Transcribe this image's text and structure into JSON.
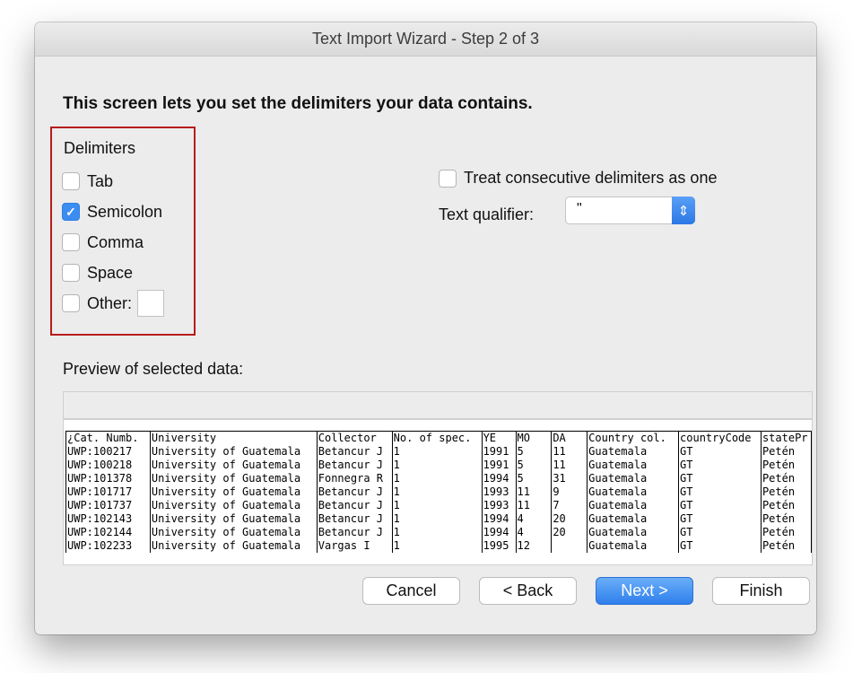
{
  "window": {
    "title": "Text Import Wizard - Step 2 of 3"
  },
  "headline": "This screen lets you set the delimiters your data contains.",
  "delimiters": {
    "title": "Delimiters",
    "tab": {
      "label": "Tab",
      "checked": false
    },
    "semicolon": {
      "label": "Semicolon",
      "checked": true
    },
    "comma": {
      "label": "Comma",
      "checked": false
    },
    "space": {
      "label": "Space",
      "checked": false
    },
    "other": {
      "label": "Other:",
      "checked": false,
      "value": ""
    }
  },
  "consecutive": {
    "label": "Treat consecutive delimiters as one",
    "checked": false
  },
  "text_qualifier": {
    "label": "Text qualifier:",
    "value": "\""
  },
  "preview": {
    "label": "Preview of selected data:",
    "headers": [
      "¿Cat. Numb.",
      "University",
      "Collector",
      "No. of spec.",
      "YE",
      "MO",
      "DA",
      "Country col.",
      "countryCode",
      "statePr"
    ],
    "rows": [
      [
        "UWP:100217",
        "University of Guatemala",
        "Betancur J",
        "1",
        "1991",
        "5",
        "11",
        "Guatemala",
        "GT",
        "Petén"
      ],
      [
        "UWP:100218",
        "University of Guatemala",
        "Betancur J",
        "1",
        "1991",
        "5",
        "11",
        "Guatemala",
        "GT",
        "Petén"
      ],
      [
        "UWP:101378",
        "University of Guatemala",
        "Fonnegra R",
        "1",
        "1994",
        "5",
        "31",
        "Guatemala",
        "GT",
        "Petén"
      ],
      [
        "UWP:101717",
        "University of Guatemala",
        "Betancur J",
        "1",
        "1993",
        "11",
        "9",
        "Guatemala",
        "GT",
        "Petén"
      ],
      [
        "UWP:101737",
        "University of Guatemala",
        "Betancur J",
        "1",
        "1993",
        "11",
        "7",
        "Guatemala",
        "GT",
        "Petén"
      ],
      [
        "UWP:102143",
        "University of Guatemala",
        "Betancur J",
        "1",
        "1994",
        "4",
        "20",
        "Guatemala",
        "GT",
        "Petén"
      ],
      [
        "UWP:102144",
        "University of Guatemala",
        "Betancur J",
        "1",
        "1994",
        "4",
        "20",
        "Guatemala",
        "GT",
        "Petén"
      ],
      [
        "UWP:102233",
        "University of Guatemala",
        "Vargas I",
        "1",
        "1995",
        "12",
        "",
        "Guatemala",
        "GT",
        "Petén"
      ]
    ]
  },
  "buttons": {
    "cancel": "Cancel",
    "back": "< Back",
    "next": "Next >",
    "finish": "Finish"
  },
  "colors": {
    "accent": "#3b8df1",
    "highlight_border": "#b71c1c"
  }
}
